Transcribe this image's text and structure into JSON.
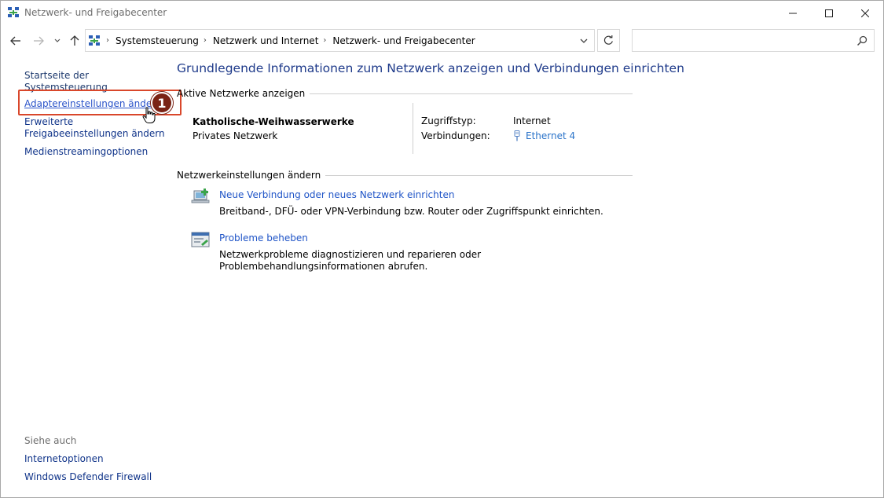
{
  "window": {
    "title": "Netzwerk- und Freigabecenter"
  },
  "navigation": {
    "breadcrumbs": [
      {
        "label": "Systemsteuerung"
      },
      {
        "label": "Netzwerk und Internet"
      },
      {
        "label": "Netzwerk- und Freigabecenter"
      }
    ],
    "search_placeholder": ""
  },
  "sidebar": {
    "home": "Startseite der Systemsteuerung",
    "adapter": "Adaptereinstellungen ändern",
    "sharing": "Erweiterte Freigabeeinstellungen ändern",
    "media": "Medienstreamingoptionen",
    "see_also": "Siehe auch",
    "internet_options": "Internetoptionen",
    "firewall": "Windows Defender Firewall"
  },
  "annotation": {
    "step": "1",
    "color": "#d9472b",
    "badge_color": "#7a2315"
  },
  "main": {
    "title": "Grundlegende Informationen zum Netzwerk anzeigen und Verbindungen einrichten",
    "active_networks": {
      "heading": "Aktive Netzwerke anzeigen",
      "network_name": "Katholische-Weihwasserwerke",
      "network_type": "Privates Netzwerk",
      "access_type_label": "Zugriffstyp:",
      "access_type_value": "Internet",
      "connections_label": "Verbindungen:",
      "connections_value": "Ethernet 4"
    },
    "settings": {
      "heading": "Netzwerkeinstellungen ändern",
      "tasks": [
        {
          "icon": "new-connection-icon",
          "link": "Neue Verbindung oder neues Netzwerk einrichten",
          "description": "Breitband-, DFÜ- oder VPN-Verbindung bzw. Router oder Zugriffspunkt einrichten."
        },
        {
          "icon": "troubleshoot-icon",
          "link": "Probleme beheben",
          "description": "Netzwerkprobleme diagnostizieren und reparieren oder Problembehandlungsinformationen abrufen."
        }
      ]
    }
  },
  "colors": {
    "title_blue": "#1e3a8a",
    "link_blue": "#1f54c7",
    "nav_link": "#0f3389"
  }
}
